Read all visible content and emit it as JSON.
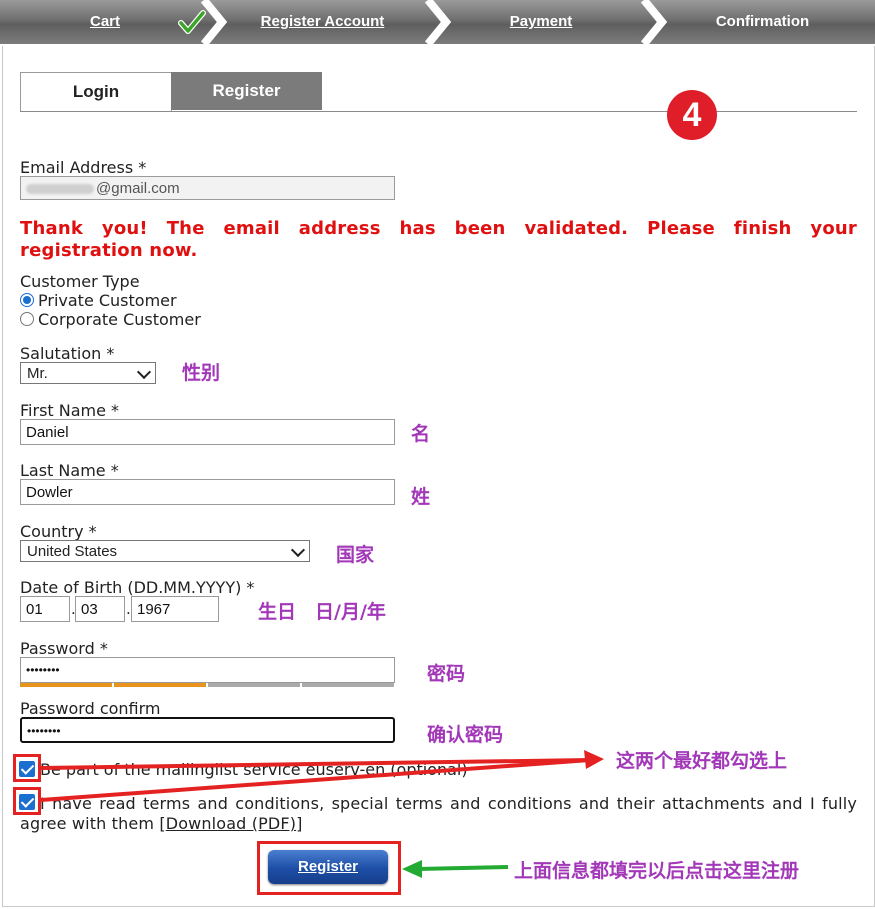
{
  "steps": [
    {
      "label": "Cart",
      "link": true
    },
    {
      "label": "Register Account",
      "link": true
    },
    {
      "label": "Payment",
      "link": true
    },
    {
      "label": "Confirmation",
      "link": false
    }
  ],
  "tabs": {
    "login": "Login",
    "register": "Register"
  },
  "step_badge": "4",
  "email": {
    "label": "Email Address *",
    "value": "@gmail.com"
  },
  "success_message": "Thank you! The email address has been validated. Please finish your registration now.",
  "customer_type": {
    "label": "Customer Type",
    "options": [
      "Private Customer",
      "Corporate Customer"
    ],
    "selected": "Private Customer"
  },
  "salutation": {
    "label": "Salutation *",
    "value": "Mr."
  },
  "first_name": {
    "label": "First Name *",
    "value": "Daniel"
  },
  "last_name": {
    "label": "Last Name *",
    "value": "Dowler"
  },
  "country": {
    "label": "Country *",
    "value": "United States"
  },
  "dob": {
    "label": "Date of Birth (DD.MM.YYYY) *",
    "day": "01",
    "month": "03",
    "year": "1967",
    "sep": "."
  },
  "password": {
    "label": "Password *",
    "value": "••••••••",
    "strength_segments": 2,
    "strength_total": 4
  },
  "password_confirm": {
    "label": "Password confirm",
    "value": "••••••••"
  },
  "mailinglist": {
    "label": "Be part of the mailinglist service euserv-en (optional)",
    "checked": true
  },
  "terms": {
    "label": "I have read terms and conditions, special terms and conditions and their attachments and I fully agree with them ",
    "link_open": "[",
    "link": "Download (PDF)",
    "link_close": "]",
    "checked": true
  },
  "register_button": "Register",
  "annotations": {
    "salutation": "性别",
    "first_name": "名",
    "last_name": "姓",
    "country": "国家",
    "dob": "生日　日/月/年",
    "password": "密码",
    "password_confirm": "确认密码",
    "checkboxes": "这两个最好都勾选上",
    "register": "上面信息都填完以后点击这里注册"
  },
  "colors": {
    "accent": "#1a6fd1",
    "error": "#e01010",
    "annotation": "#a238b8",
    "arrow_red": "#e52222",
    "arrow_green": "#22aa33",
    "strength": "#e8941c"
  }
}
